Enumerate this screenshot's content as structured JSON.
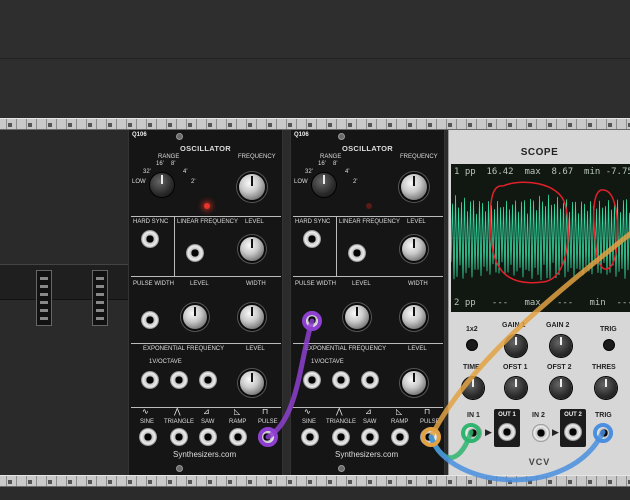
{
  "oscillator": {
    "brand": "Q106",
    "title": "OSCILLATOR",
    "range_label": "RANGE",
    "range_marks": [
      "16'",
      "8'",
      "32'",
      "4'",
      "LOW",
      "2'"
    ],
    "frequency_label": "FREQUENCY",
    "hard_sync_label": "HARD SYNC",
    "linear_frequency_label": "LINEAR FREQUENCY",
    "level_label": "LEVEL",
    "pulse_width_label": "PULSE WIDTH",
    "width_label": "WIDTH",
    "exp_frequency_label": "EXPONENTIAL FREQUENCY",
    "v_oct_label": "1V/OCTAVE",
    "outputs": [
      "SINE",
      "TRIANGLE",
      "SAW",
      "RAMP",
      "PULSE"
    ],
    "footer": "Synthesizers.com"
  },
  "scope": {
    "title": "SCOPE",
    "readout1": "1 pp  16.42  max  8.67  min -7.75",
    "readout2": "2 pp   ---   max   ---   min  ---",
    "btn_1x2": "1x2",
    "gain1": "GAIN 1",
    "gain2": "GAIN 2",
    "trig": "TRIG",
    "time": "TIME",
    "ofst1": "OFST 1",
    "ofst2": "OFST 2",
    "thres": "THRES",
    "in1": "IN 1",
    "out1": "OUT 1",
    "in2": "IN 2",
    "out2": "OUT 2",
    "trig_jack": "TRIG",
    "brand": "VCV",
    "trace_color": "#34d8a0",
    "annotation_color": "#e0202a"
  },
  "cable_colors": {
    "purple": "#8e3fd0",
    "orange": "#e2a243",
    "green": "#2fb56f",
    "blue": "#4a8fe0"
  }
}
